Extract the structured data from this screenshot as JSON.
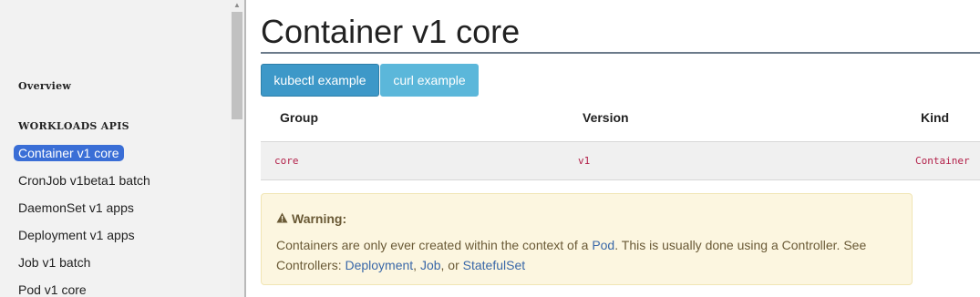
{
  "sidebar": {
    "overview": "Overview",
    "section_heading": "WORKLOADS APIS",
    "items": [
      {
        "label": "Container v1 core"
      },
      {
        "label": "CronJob v1beta1 batch"
      },
      {
        "label": "DaemonSet v1 apps"
      },
      {
        "label": "Deployment v1 apps"
      },
      {
        "label": "Job v1 batch"
      },
      {
        "label": "Pod v1 core"
      }
    ]
  },
  "page": {
    "title": "Container v1 core",
    "tabs": [
      "kubectl example",
      "curl example"
    ]
  },
  "table": {
    "headers": {
      "group": "Group",
      "version": "Version",
      "kind": "Kind"
    },
    "row": {
      "group": "core",
      "version": "v1",
      "kind": "Container"
    }
  },
  "warning": {
    "icon": "warning-icon",
    "title": "Warning:",
    "text_1": "Containers are only ever created within the context of a ",
    "link_pod": "Pod",
    "text_2": ". This is usually done using a Controller. See Controllers: ",
    "link_deployment": "Deployment",
    "sep_1": ", ",
    "link_job": "Job",
    "sep_2": ", or ",
    "link_statefulset": "StatefulSet"
  },
  "colors": {
    "active_nav": "#3a6ed6",
    "kubectl_tab": "#3d98c8",
    "curl_tab": "#5bb7da",
    "code_text": "#b3214a",
    "warning_bg": "#fcf6e0",
    "link": "#3a68a8"
  }
}
